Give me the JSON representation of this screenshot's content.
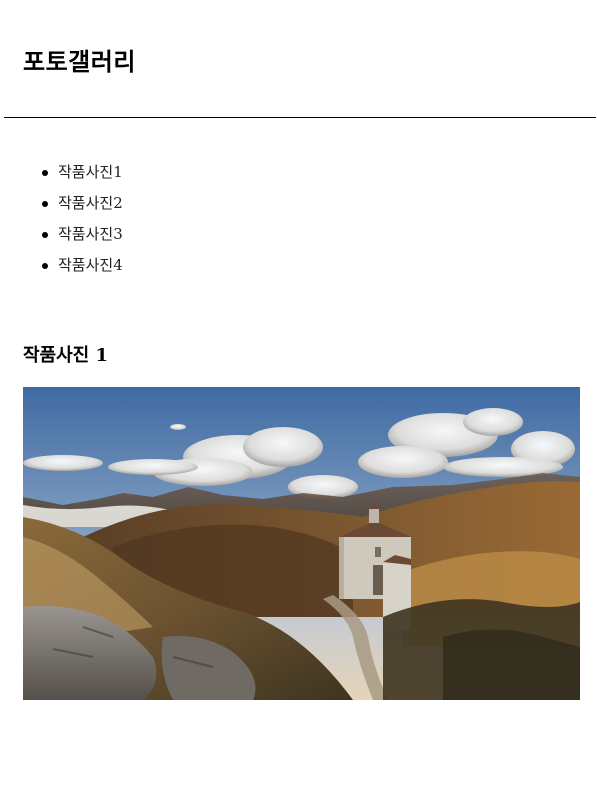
{
  "header": {
    "title": "포토갤러리"
  },
  "nav": {
    "items": [
      {
        "label": "작품사진1"
      },
      {
        "label": "작품사진2"
      },
      {
        "label": "작품사진3"
      },
      {
        "label": "작품사진4"
      }
    ]
  },
  "section": {
    "heading": "작품사진 1"
  },
  "colors": {
    "text": "#000000",
    "background": "#ffffff",
    "sky": "#4a6fa0",
    "hills": "#6b4a2a",
    "building": "#cfc9bd"
  }
}
